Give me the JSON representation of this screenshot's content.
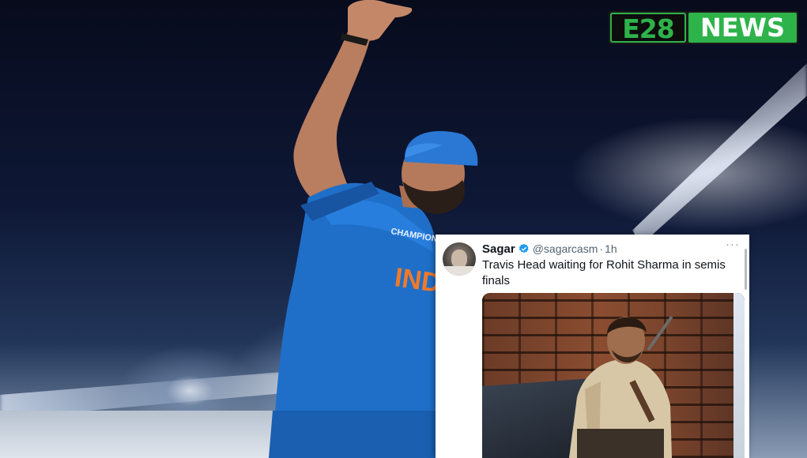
{
  "logo": {
    "part1": "E28",
    "part2": "NEWS",
    "colors": {
      "green": "#2db34a",
      "dark": "#0d0d0d",
      "white": "#ffffff"
    }
  },
  "background": {
    "description_tag": "cricket-stadium-photo",
    "jersey_text": "IND",
    "jersey_color": "#1f6fc9"
  },
  "tweet": {
    "name": "Sagar",
    "handle": "@sagarcasm",
    "separator": "·",
    "time": "1h",
    "more": "···",
    "text": "Travis Head waiting for Rohit Sharma in semis finals",
    "verified_color": "#1d9bf0"
  }
}
